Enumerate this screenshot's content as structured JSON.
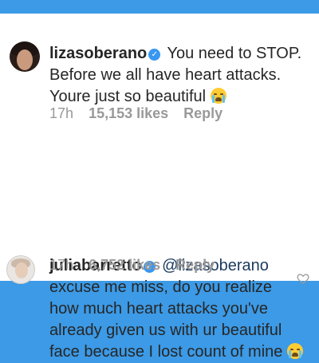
{
  "comments": [
    {
      "username": "lizasoberano",
      "text": "You need to STOP. Before we all have heart attacks. Youre just so beautiful",
      "time": "17h",
      "likes": "15,153 likes",
      "reply_label": "Reply"
    },
    {
      "username": "juliabarretto",
      "mention": "@lizasoberano",
      "text": "excuse me miss, do you realize how much heart attacks you've already given us with ur beautiful face because I lost count of mine",
      "time": "17h",
      "likes": "6,752 likes",
      "reply_label": "Reply"
    }
  ],
  "icons": {
    "verified": "verified-badge-icon",
    "emoji": "crying-face-emoji-icon",
    "like": "heart-outline-icon"
  },
  "colors": {
    "background": "#3c9ae6",
    "verified": "#3897f0",
    "mention": "#1a3a5f",
    "meta": "#999999"
  }
}
